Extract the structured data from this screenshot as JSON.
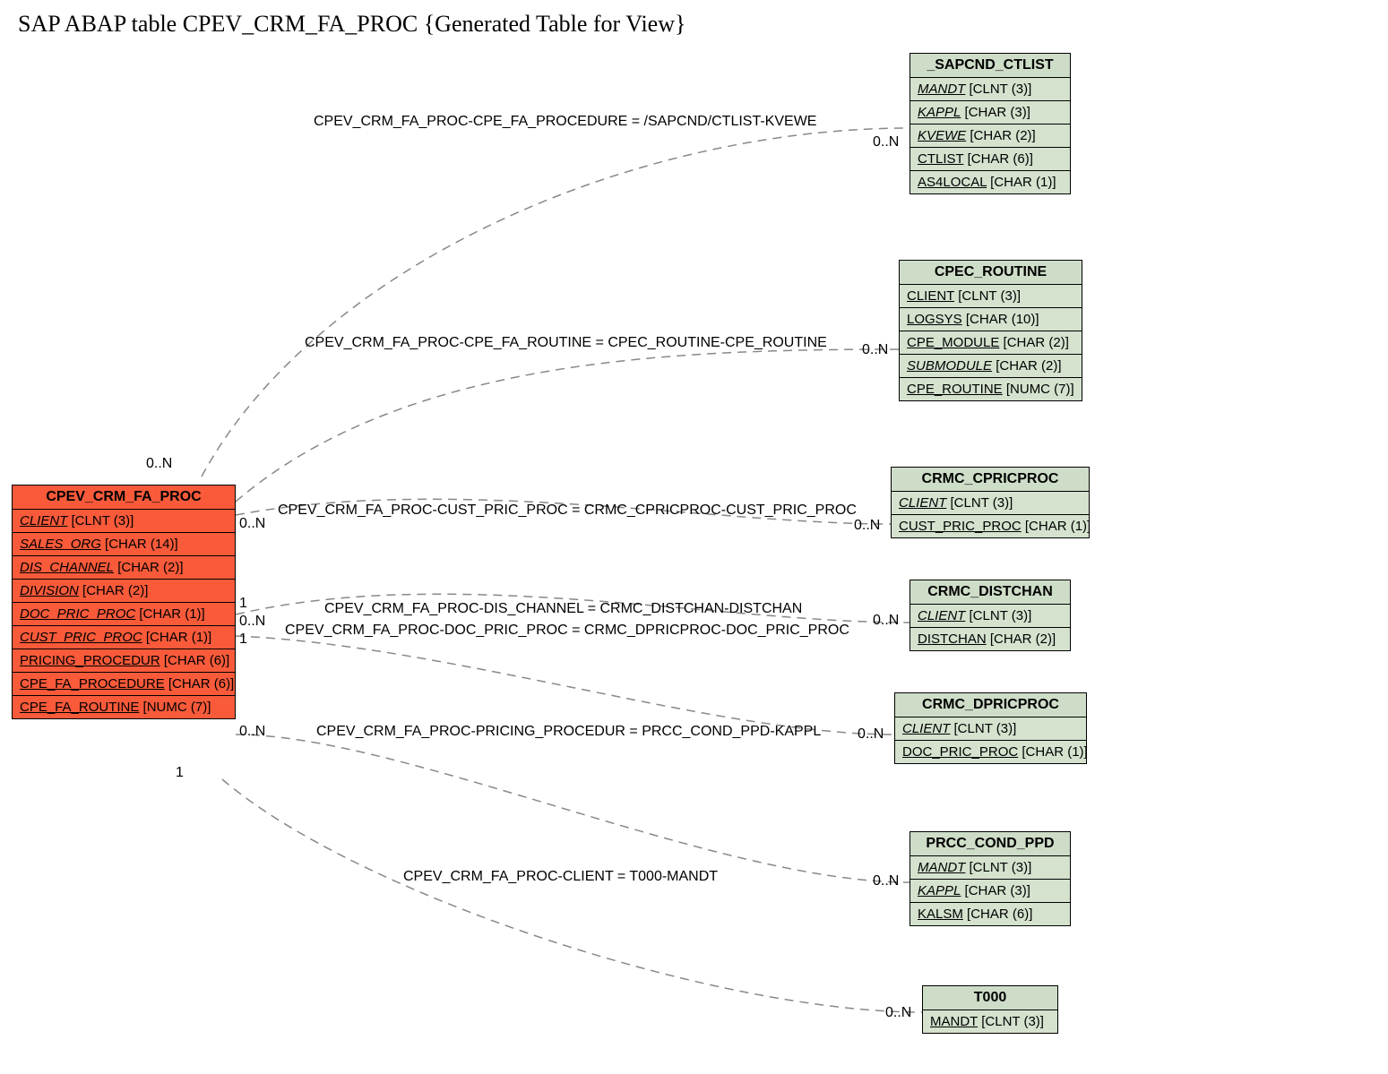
{
  "title": "SAP ABAP table CPEV_CRM_FA_PROC {Generated Table for View}",
  "main_entity": {
    "name": "CPEV_CRM_FA_PROC",
    "fields": [
      {
        "name": "CLIENT",
        "type": "[CLNT (3)]",
        "italic": true
      },
      {
        "name": "SALES_ORG",
        "type": "[CHAR (14)]",
        "italic": true
      },
      {
        "name": "DIS_CHANNEL",
        "type": "[CHAR (2)]",
        "italic": true
      },
      {
        "name": "DIVISION",
        "type": "[CHAR (2)]",
        "italic": true
      },
      {
        "name": "DOC_PRIC_PROC",
        "type": "[CHAR (1)]",
        "italic": true
      },
      {
        "name": "CUST_PRIC_PROC",
        "type": "[CHAR (1)]",
        "italic": true
      },
      {
        "name": "PRICING_PROCEDUR",
        "type": "[CHAR (6)]",
        "italic": false
      },
      {
        "name": "CPE_FA_PROCEDURE",
        "type": "[CHAR (6)]",
        "italic": false
      },
      {
        "name": "CPE_FA_ROUTINE",
        "type": "[NUMC (7)]",
        "italic": false
      }
    ]
  },
  "related_entities": [
    {
      "name": "_SAPCND_CTLIST",
      "fields": [
        {
          "name": "MANDT",
          "type": "[CLNT (3)]",
          "italic": true
        },
        {
          "name": "KAPPL",
          "type": "[CHAR (3)]",
          "italic": true
        },
        {
          "name": "KVEWE",
          "type": "[CHAR (2)]",
          "italic": true
        },
        {
          "name": "CTLIST",
          "type": "[CHAR (6)]",
          "italic": false
        },
        {
          "name": "AS4LOCAL",
          "type": "[CHAR (1)]",
          "italic": false
        }
      ]
    },
    {
      "name": "CPEC_ROUTINE",
      "fields": [
        {
          "name": "CLIENT",
          "type": "[CLNT (3)]",
          "italic": false
        },
        {
          "name": "LOGSYS",
          "type": "[CHAR (10)]",
          "italic": false
        },
        {
          "name": "CPE_MODULE",
          "type": "[CHAR (2)]",
          "italic": false
        },
        {
          "name": "SUBMODULE",
          "type": "[CHAR (2)]",
          "italic": true
        },
        {
          "name": "CPE_ROUTINE",
          "type": "[NUMC (7)]",
          "italic": false
        }
      ]
    },
    {
      "name": "CRMC_CPRICPROC",
      "fields": [
        {
          "name": "CLIENT",
          "type": "[CLNT (3)]",
          "italic": true
        },
        {
          "name": "CUST_PRIC_PROC",
          "type": "[CHAR (1)]",
          "italic": false
        }
      ]
    },
    {
      "name": "CRMC_DISTCHAN",
      "fields": [
        {
          "name": "CLIENT",
          "type": "[CLNT (3)]",
          "italic": true
        },
        {
          "name": "DISTCHAN",
          "type": "[CHAR (2)]",
          "italic": false
        }
      ]
    },
    {
      "name": "CRMC_DPRICPROC",
      "fields": [
        {
          "name": "CLIENT",
          "type": "[CLNT (3)]",
          "italic": true
        },
        {
          "name": "DOC_PRIC_PROC",
          "type": "[CHAR (1)]",
          "italic": false
        }
      ]
    },
    {
      "name": "PRCC_COND_PPD",
      "fields": [
        {
          "name": "MANDT",
          "type": "[CLNT (3)]",
          "italic": true
        },
        {
          "name": "KAPPL",
          "type": "[CHAR (3)]",
          "italic": true
        },
        {
          "name": "KALSM",
          "type": "[CHAR (6)]",
          "italic": false
        }
      ]
    },
    {
      "name": "T000",
      "fields": [
        {
          "name": "MANDT",
          "type": "[CLNT (3)]",
          "italic": false
        }
      ]
    }
  ],
  "relations": [
    {
      "label": "CPEV_CRM_FA_PROC-CPE_FA_PROCEDURE = /SAPCND/CTLIST-KVEWE"
    },
    {
      "label": "CPEV_CRM_FA_PROC-CPE_FA_ROUTINE = CPEC_ROUTINE-CPE_ROUTINE"
    },
    {
      "label": "CPEV_CRM_FA_PROC-CUST_PRIC_PROC = CRMC_CPRICPROC-CUST_PRIC_PROC"
    },
    {
      "label": "CPEV_CRM_FA_PROC-DIS_CHANNEL = CRMC_DISTCHAN-DISTCHAN"
    },
    {
      "label": "CPEV_CRM_FA_PROC-DOC_PRIC_PROC = CRMC_DPRICPROC-DOC_PRIC_PROC"
    },
    {
      "label": "CPEV_CRM_FA_PROC-PRICING_PROCEDUR = PRCC_COND_PPD-KAPPL"
    },
    {
      "label": "CPEV_CRM_FA_PROC-CLIENT = T000-MANDT"
    }
  ],
  "cardinalities": {
    "main_top": "0..N",
    "main_mid_one_a": "1",
    "main_mid_0n": "0..N",
    "main_mid_one_b": "1",
    "main_bottom_0n": "0..N",
    "main_bottom_1": "1",
    "r1": "0..N",
    "r2": "0..N",
    "r3": "0..N",
    "r4": "0..N",
    "r5": "0..N",
    "r6": "0..N",
    "r7": "0..N"
  }
}
